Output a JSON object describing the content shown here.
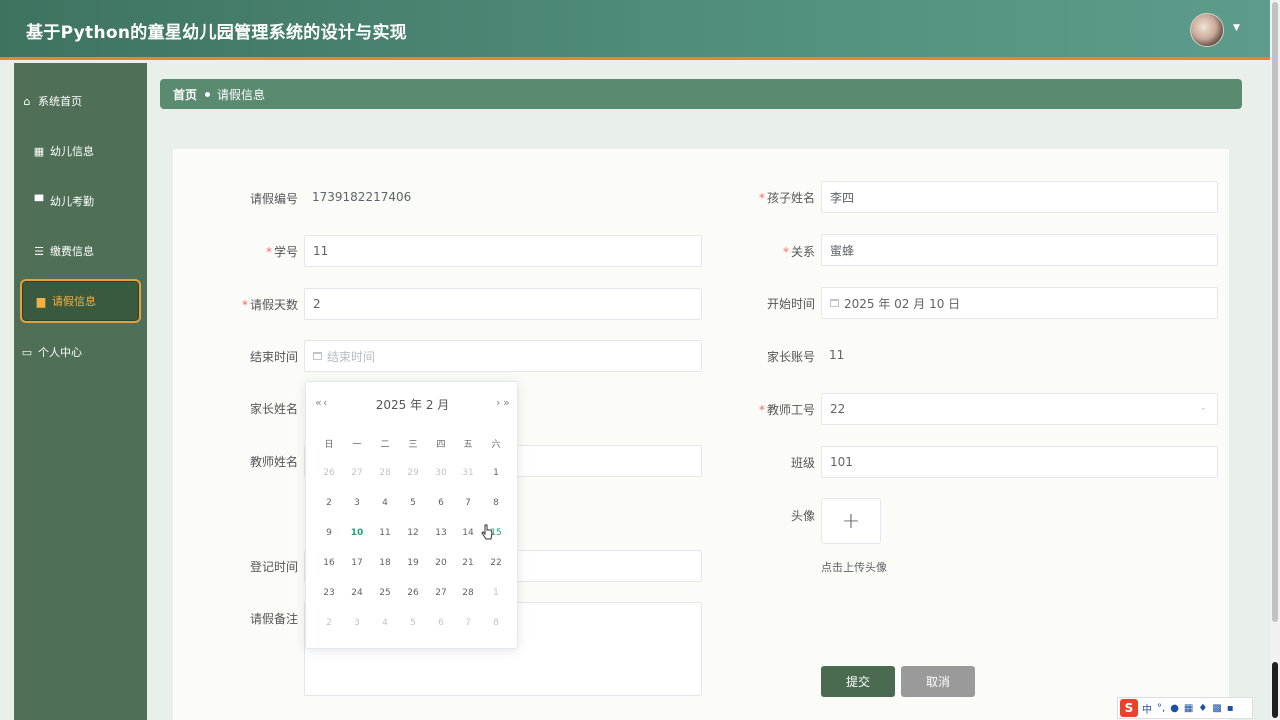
{
  "app": {
    "title": "基于Python的童星幼儿园管理系统的设计与实现"
  },
  "sidebar": {
    "items": [
      {
        "label": "系统首页",
        "icon": "home-icon",
        "glyph": "⌂"
      },
      {
        "label": "幼儿信息",
        "icon": "grid-icon",
        "glyph": "▦"
      },
      {
        "label": "幼儿考勤",
        "icon": "monitor-icon",
        "glyph": "▀"
      },
      {
        "label": "缴费信息",
        "icon": "list-icon",
        "glyph": "☰"
      },
      {
        "label": "请假信息",
        "icon": "document-icon",
        "glyph": "▆",
        "active": true
      },
      {
        "label": "个人中心",
        "icon": "panel-icon",
        "glyph": "▭"
      }
    ]
  },
  "breadcrumb": {
    "home": "首页",
    "current": "请假信息"
  },
  "form": {
    "leave_no": {
      "label": "请假编号",
      "value": "1739182217406"
    },
    "child_name": {
      "label": "孩子姓名",
      "value": "李四"
    },
    "student_no": {
      "label": "学号",
      "value": "11"
    },
    "relation": {
      "label": "关系",
      "value": "蜜蜂"
    },
    "leave_days": {
      "label": "请假天数",
      "value": "2"
    },
    "start_time": {
      "label": "开始时间",
      "value": "2025 年 02 月 10 日"
    },
    "end_time": {
      "label": "结束时间",
      "placeholder": "结束时间"
    },
    "parent_account": {
      "label": "家长账号",
      "value": "11"
    },
    "parent_name": {
      "label": "家长姓名"
    },
    "teacher_no": {
      "label": "教师工号",
      "value": "22"
    },
    "teacher_name": {
      "label": "教师姓名"
    },
    "class": {
      "label": "班级",
      "value": "101"
    },
    "avatar": {
      "label": "头像",
      "upload_hint": "点击上传头像"
    },
    "register_time": {
      "label": "登记时间"
    },
    "remark": {
      "label": "请假备注"
    },
    "submit": "提交",
    "cancel": "取消"
  },
  "datepicker": {
    "header": "2025 年  2 月",
    "prev_year": "«",
    "prev_month": "‹",
    "next_month": "›",
    "next_year": "»",
    "weekdays": [
      "日",
      "一",
      "二",
      "三",
      "四",
      "五",
      "六"
    ],
    "today": "10",
    "weeks": [
      [
        "26",
        "27",
        "28",
        "29",
        "30",
        "31",
        "1"
      ],
      [
        "2",
        "3",
        "4",
        "5",
        "6",
        "7",
        "8"
      ],
      [
        "9",
        "10",
        "11",
        "12",
        "13",
        "14",
        "15"
      ],
      [
        "16",
        "17",
        "18",
        "19",
        "20",
        "21",
        "22"
      ],
      [
        "23",
        "24",
        "25",
        "26",
        "27",
        "28",
        "1"
      ],
      [
        "2",
        "3",
        "4",
        "5",
        "6",
        "7",
        "8"
      ]
    ]
  },
  "ime": {
    "logo": "S",
    "mode": "中"
  },
  "colors": {
    "accent": "#1aa37a",
    "sidebar": "#4f7056",
    "active_border": "#e7a13a",
    "header_line": "#e8842e"
  }
}
